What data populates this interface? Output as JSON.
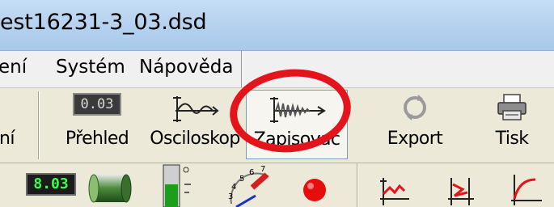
{
  "window": {
    "title": "est16231-3_03.dsd"
  },
  "menu": {
    "items": [
      "ení",
      "Systém",
      "Nápověda"
    ]
  },
  "toolbar": {
    "items": [
      {
        "label": "ní",
        "icon": "partial-icon"
      },
      {
        "label": "Přehled",
        "icon": "lcd-display-icon",
        "display": "0.03"
      },
      {
        "label": "Osciloskop",
        "icon": "oscilloscope-icon"
      },
      {
        "label": "Zapisovač",
        "icon": "recorder-icon"
      },
      {
        "label": "Export",
        "icon": "refresh-export-icon"
      },
      {
        "label": "Tisk",
        "icon": "printer-icon"
      }
    ]
  },
  "toolbar2": {
    "lcd_value": "8.03",
    "gauge_numbers": [
      "3",
      "4",
      "5",
      "6",
      "7"
    ],
    "icons": [
      "lcd-meter-icon",
      "cylinder-icon",
      "level-gauge-icon",
      "dial-gauge-icon",
      "red-indicator-icon",
      "chart-window-icon",
      "bracket-chart-icon",
      "curve-chart-icon"
    ]
  },
  "highlight": {
    "color": "#e3141b"
  }
}
